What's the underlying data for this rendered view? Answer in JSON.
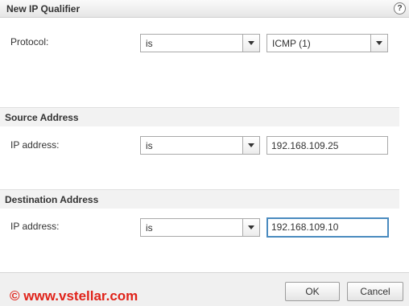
{
  "dialog": {
    "title": "New IP Qualifier",
    "help_glyph": "?"
  },
  "protocol": {
    "label": "Protocol:",
    "operator": "is",
    "value": "ICMP (1)"
  },
  "source": {
    "section_title": "Source Address",
    "label": "IP address:",
    "operator": "is",
    "value": "192.168.109.25"
  },
  "destination": {
    "section_title": "Destination Address",
    "label": "IP address:",
    "operator": "is",
    "value": "192.168.109.10"
  },
  "footer": {
    "watermark": "© www.vstellar.com",
    "ok_label": "OK",
    "cancel_label": "Cancel"
  }
}
